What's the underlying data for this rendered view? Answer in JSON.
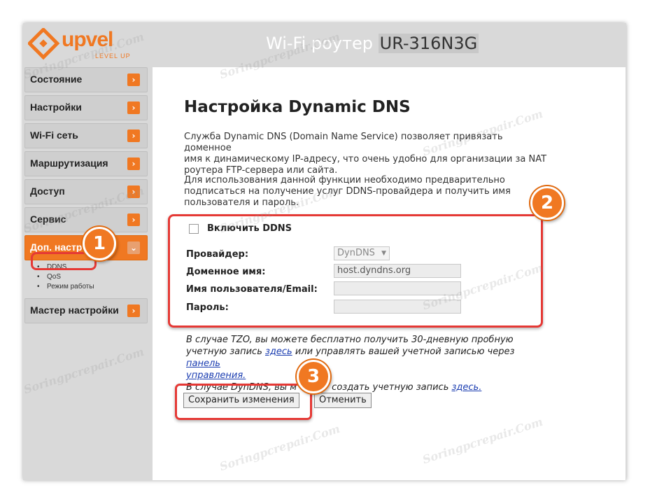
{
  "header": {
    "logo_text": "upvel",
    "logo_sub": "LEVEL UP",
    "heading_prefix": "Wi-Fi роутер ",
    "model": "UR-316N3G"
  },
  "sidebar": {
    "items": [
      {
        "label": "Состояние"
      },
      {
        "label": "Настройки"
      },
      {
        "label": "Wi-Fi сеть"
      },
      {
        "label": "Маршрутизация"
      },
      {
        "label": "Доступ"
      },
      {
        "label": "Сервис"
      },
      {
        "label": "Доп. настр"
      },
      {
        "label": "Мастер настройки"
      }
    ],
    "subitems": [
      "DDNS",
      "QoS",
      "Режим работы"
    ]
  },
  "main": {
    "title": "Настройка Dynamic DNS",
    "p1_lines": [
      "Служба Dynamic DNS (Domain Name Service) позволяет привязать доменное",
      "имя к динамическому IP-адресу, что очень удобно для организации за NAT",
      "роутера FTP-сервера или сайта."
    ],
    "p2_lines": [
      "Для использования данной функции необходимо предварительно",
      "подписаться на получение услуг DDNS-провайдера и получить имя",
      "пользователя и пароль."
    ],
    "enable_label": "Включить DDNS",
    "provider_label": "Провайдер:",
    "provider_value": "DynDNS",
    "domain_label": "Доменное имя:",
    "domain_value": "host.dyndns.org",
    "user_label": "Имя пользователя/Email:",
    "user_value": "",
    "password_label": "Пароль:",
    "password_value": "",
    "note_tzo_1": "В случае TZO, вы можете бесплатно получить 30-дневную пробную",
    "note_tzo_2a": "учетную запись ",
    "note_tzo_link1": "здесь",
    "note_tzo_2b": " или управлять вашей учетной записью через ",
    "note_tzo_link2a": "панель",
    "note_tzo_link2b": "управления.",
    "note_dyn_a": "В случае DynDNS, вы м",
    "note_dyn_b": " создать учетную запись ",
    "note_dyn_link": "здесь.",
    "save_label": "Сохранить изменения",
    "cancel_label": "Отменить"
  },
  "badges": {
    "one": "1",
    "two": "2",
    "three": "3"
  },
  "watermark": "Soringpcrepair.Com",
  "colors": {
    "accent": "#f07822",
    "highlight": "#e53935",
    "link": "#1a3cb0"
  }
}
